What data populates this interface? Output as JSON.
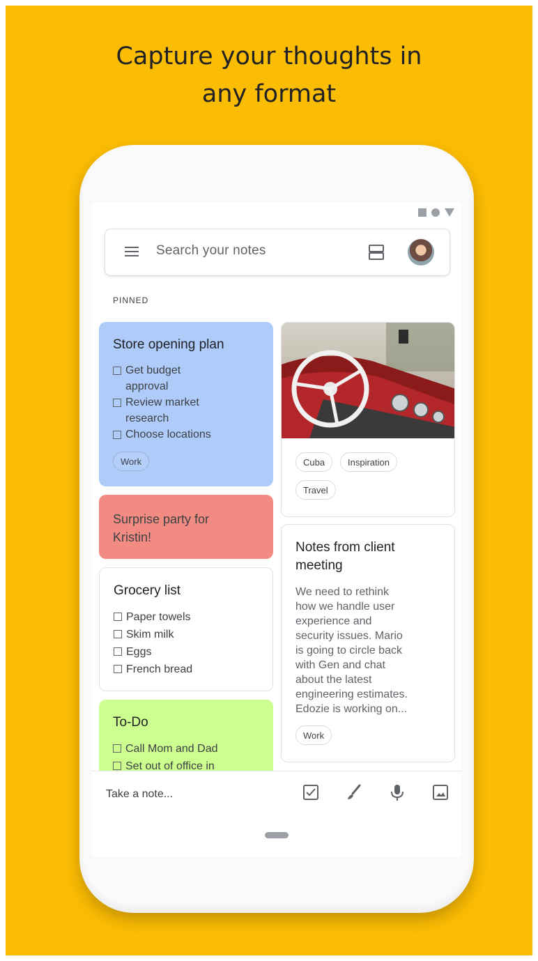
{
  "headline": {
    "line1": "Capture your thoughts in",
    "line2": "any format"
  },
  "search": {
    "placeholder": "Search your notes"
  },
  "section_label": "PINNED",
  "notes": {
    "store": {
      "title": "Store opening plan",
      "items": [
        {
          "line1": "Get budget",
          "line2": "approval"
        },
        {
          "line1": "Review market",
          "line2": "research"
        },
        {
          "line1": "Choose locations",
          "line2": ""
        }
      ],
      "label": "Work"
    },
    "party": {
      "text1": "Surprise party for",
      "text2": "Kristin!"
    },
    "grocery": {
      "title": "Grocery list",
      "items": [
        "Paper towels",
        "Skim milk",
        "Eggs",
        "French bread"
      ]
    },
    "todo": {
      "title": "To-Do",
      "items": [
        "Call Mom and Dad",
        "Set out of office in"
      ]
    },
    "photo": {
      "labels": [
        "Cuba",
        "Inspiration",
        "Travel"
      ]
    },
    "meeting": {
      "title1": "Notes from client",
      "title2": "meeting",
      "lines": [
        "We need to rethink",
        "how we handle user",
        "experience and",
        "security issues. Mario",
        "is going to circle back",
        "with Gen and chat",
        "about the latest",
        "engineering estimates.",
        "Edozie is working on..."
      ],
      "label": "Work"
    }
  },
  "bottom": {
    "take_note": "Take a note..."
  },
  "colors": {
    "background": "#FBBC04",
    "blue_note": "#aecbfa",
    "red_note": "#f28b82",
    "green_note": "#ccff90",
    "yellow_note": "#fff475"
  },
  "icons": [
    "menu-icon",
    "list-view-icon",
    "avatar",
    "checkbox-icon",
    "brush-icon",
    "mic-icon",
    "image-icon"
  ]
}
